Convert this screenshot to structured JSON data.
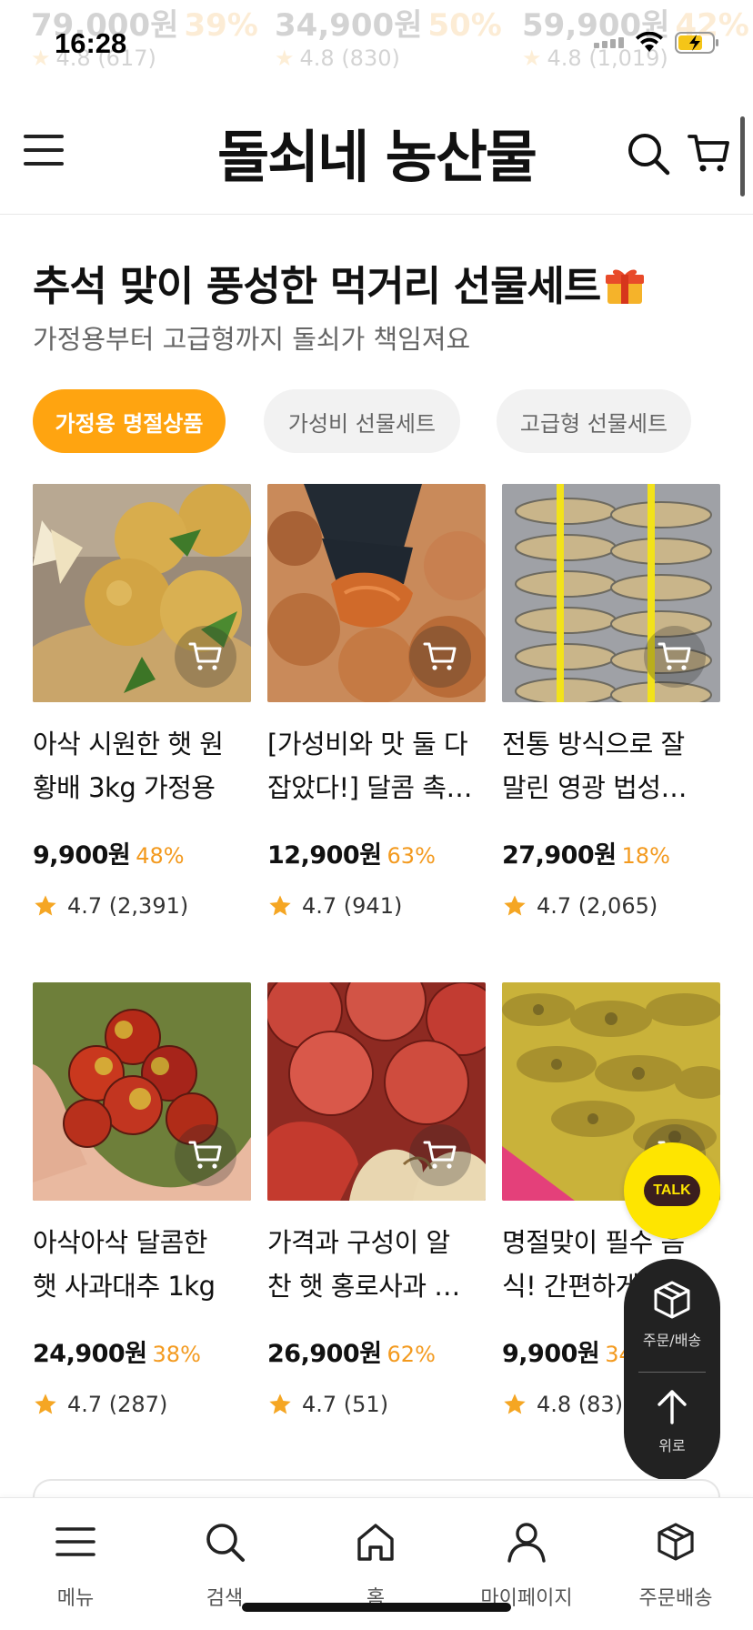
{
  "status_bar": {
    "time": "16:28"
  },
  "ghost_row": [
    {
      "price": "79,000원",
      "discount": "39%",
      "rating": "4.8 (617)"
    },
    {
      "price": "34,900원",
      "discount": "50%",
      "rating": "4.8 (830)"
    },
    {
      "price": "59,900원",
      "discount": "42%",
      "rating": "4.8 (1,019)"
    }
  ],
  "header": {
    "logo": "돌쇠네 농산물"
  },
  "section": {
    "title": "추석 맞이 풍성한 먹거리 선물세트",
    "subtitle": "가정용부터 고급형까지 돌쇠가 책임져요"
  },
  "tabs": [
    {
      "label": "가정용 명절상품",
      "active": true
    },
    {
      "label": "가성비 선물세트",
      "active": false
    },
    {
      "label": "고급형 선물세트",
      "active": false
    }
  ],
  "products": [
    {
      "name1": "아삭 시원한 햇 원",
      "name2": "황배 3kg 가정용",
      "price": "9,900원",
      "discount": "48%",
      "rating": "4.7 (2,391)",
      "image": "asian-pears"
    },
    {
      "name1": "[가성비와 맛 둘 다",
      "name2": "잡았다!] 달콤 촉…",
      "price": "12,900원",
      "discount": "63%",
      "rating": "4.7 (941)",
      "image": "dried-persimmons"
    },
    {
      "name1": "전통 방식으로 잘",
      "name2": "말린 영광 법성…",
      "price": "27,900원",
      "discount": "18%",
      "rating": "4.7 (2,065)",
      "image": "dried-yellow-croaker"
    },
    {
      "name1": "아삭아삭 달콤한",
      "name2": "햇 사과대추 1kg",
      "price": "24,900원",
      "discount": "38%",
      "rating": "4.7 (287)",
      "image": "apple-jujubes"
    },
    {
      "name1": "가격과 구성이 알",
      "name2": "찬 햇 홍로사과 …",
      "price": "26,900원",
      "discount": "62%",
      "rating": "4.7 (51)",
      "image": "red-apples"
    },
    {
      "name1": "명절맞이 필수 음",
      "name2": "식! 간편하게 데…",
      "price": "9,900원",
      "discount": "34%",
      "rating": "4.8 (83)",
      "image": "jeon-pancakes"
    }
  ],
  "floating": {
    "talk_label": "TALK",
    "order_label": "주문/배송",
    "top_label": "위로"
  },
  "bottom_nav": [
    {
      "label": "메뉴",
      "icon": "menu-icon"
    },
    {
      "label": "검색",
      "icon": "search-icon"
    },
    {
      "label": "홈",
      "icon": "home-icon"
    },
    {
      "label": "마이페이지",
      "icon": "user-icon"
    },
    {
      "label": "주문배송",
      "icon": "box-icon"
    }
  ],
  "colors": {
    "accent": "#ffa410",
    "discount": "#f39a1f",
    "star": "#f5a623",
    "kakao": "#fee500"
  }
}
